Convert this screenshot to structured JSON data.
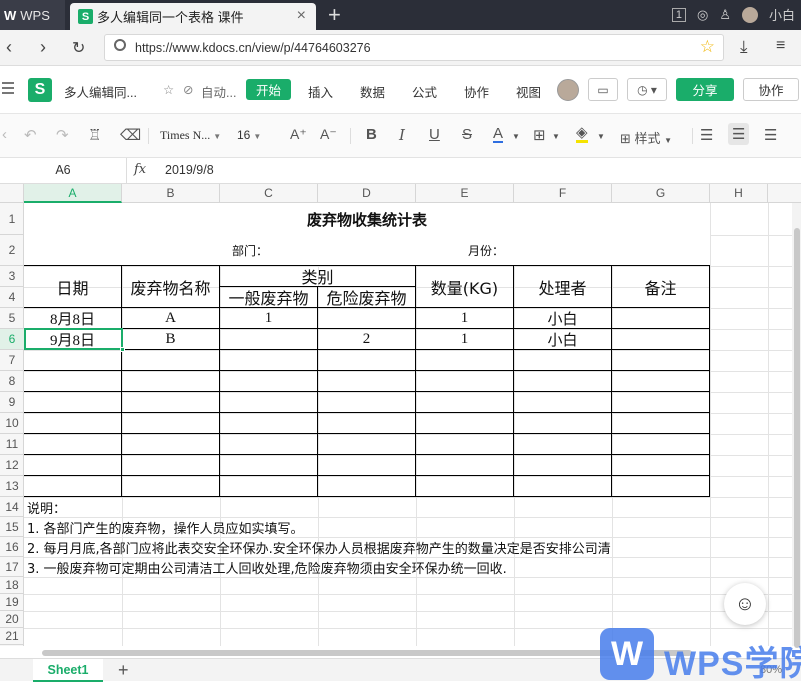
{
  "browser": {
    "home_tab_label": "WPS",
    "doc_tab_title": "多人编辑同一个表格 课件",
    "url": "https://www.kdocs.cn/view/p/44764603276",
    "user_name": "小白",
    "tab_count": "1"
  },
  "app": {
    "doc_title": "多人编辑同...",
    "autosave": "自动...",
    "menu": [
      "开始",
      "插入",
      "数据",
      "公式",
      "协作",
      "视图"
    ],
    "share_label": "分享",
    "collab_label": "协作"
  },
  "toolbar": {
    "font_name": "Times N...",
    "font_size": "16",
    "style_label": "样式"
  },
  "formula_bar": {
    "name_box": "A6",
    "fx_label": "fx",
    "formula": "2019/9/8"
  },
  "columns": [
    "A",
    "B",
    "C",
    "D",
    "E",
    "F",
    "G",
    "H"
  ],
  "rows": [
    "1",
    "2",
    "3",
    "4",
    "5",
    "6",
    "7",
    "8",
    "9",
    "10",
    "11",
    "12",
    "13",
    "14",
    "15",
    "16",
    "17",
    "18",
    "19",
    "20",
    "21"
  ],
  "sheet": {
    "title": "废弃物收集统计表",
    "dept_label": "部门：",
    "month_label": "月份：",
    "headers": {
      "date": "日期",
      "waste_name": "废弃物名称",
      "category": "类别",
      "general": "一般废弃物",
      "hazardous": "危险废弃物",
      "qty": "数量(KG)",
      "handler": "处理者",
      "remark": "备注"
    },
    "data_rows": [
      {
        "date": "8月8日",
        "name": "A",
        "general": "1",
        "hazardous": "",
        "qty": "1",
        "handler": "小白",
        "remark": ""
      },
      {
        "date": "9月8日",
        "name": "B",
        "general": "",
        "hazardous": "2",
        "qty": "1",
        "handler": "小白",
        "remark": ""
      }
    ],
    "notes": [
      "说明：",
      "1.      各部门产生的废弃物，操作人员应如实填写。",
      "2.      每月月底,各部门应将此表交安全环保办.安全环保办人员根据废弃物产生的数量决定是否安排公司清",
      "3.       一般废弃物可定期由公司清洁工人回收处理,危险废弃物须由安全环保办统一回收."
    ]
  },
  "bottom": {
    "sheet_tab": "Sheet1",
    "zoom": "80%"
  },
  "watermark": {
    "logo_letter": "W",
    "text": "WPS学院"
  },
  "colors": {
    "accent": "#1aad6a",
    "titlebar": "#2b2e38",
    "watermark": "#467deb"
  }
}
